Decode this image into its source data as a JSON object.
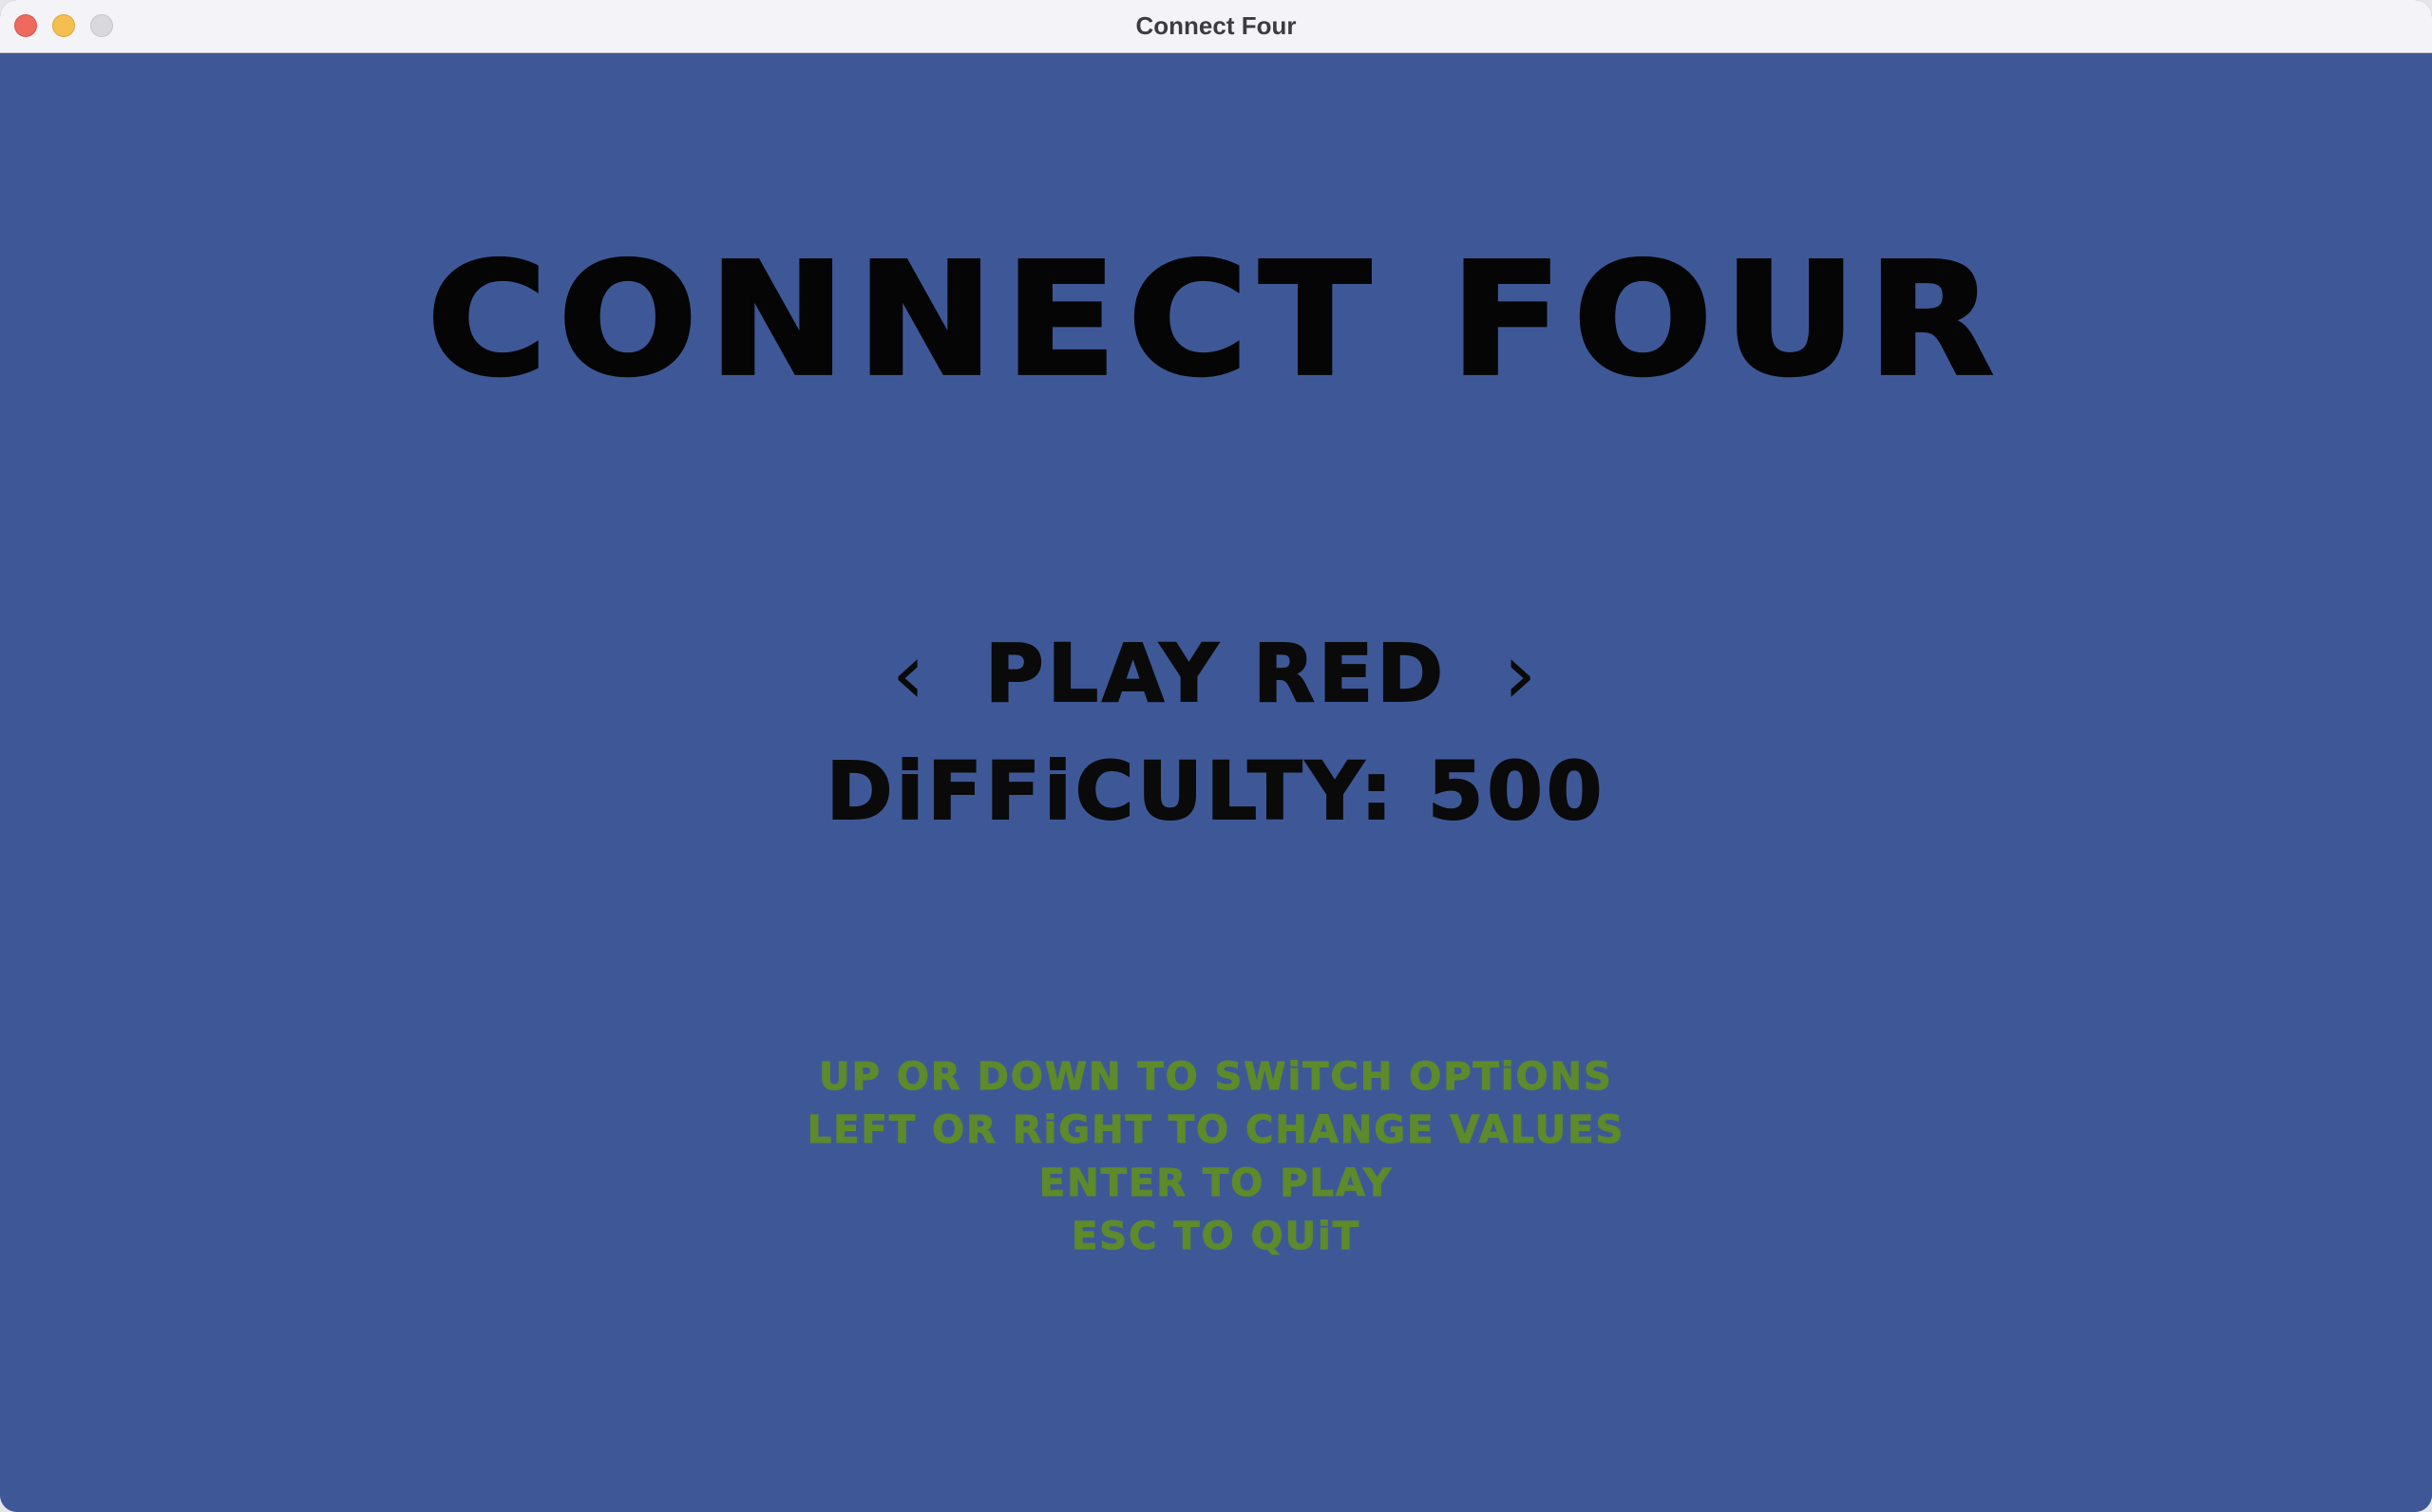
{
  "window": {
    "title": "Connect Four"
  },
  "game": {
    "title": "CONNECT FOUR",
    "player_option": {
      "left_arrow": "‹",
      "label": "PLAY RED",
      "right_arrow": "›"
    },
    "difficulty_option": {
      "label": "DiFFiCULTY: 500"
    },
    "instructions": [
      "UP OR DOWN TO SWiTCH OPTiONS",
      "LEFT OR RiGHT TO CHANGE VALUES",
      "ENTER TO PLAY",
      "ESC TO QUiT"
    ]
  },
  "colors": {
    "background": "#3e5897",
    "title_text": "#050505",
    "instruction_text": "#5d8a2b"
  }
}
